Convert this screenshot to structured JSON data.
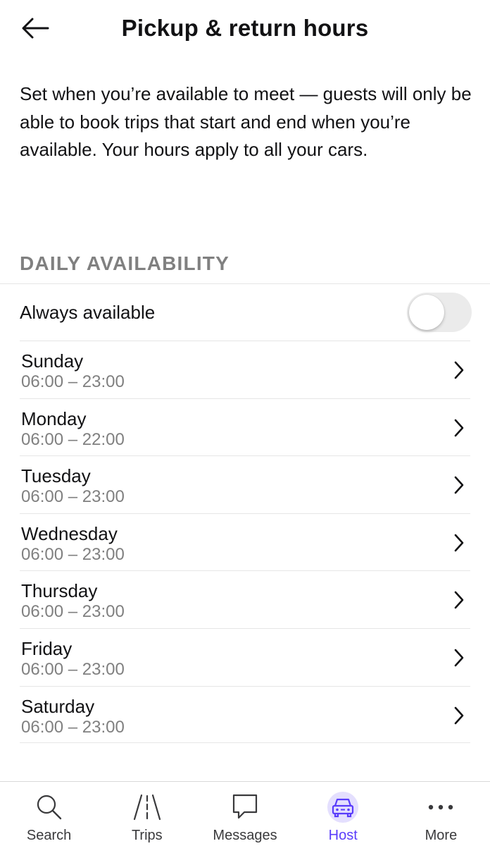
{
  "header": {
    "title": "Pickup & return hours"
  },
  "intro": "Set when you’re available to meet — guests will only be able to book trips that start and end when you’re available. Your hours apply to all your cars.",
  "section_label": "DAILY AVAILABILITY",
  "always_available": {
    "label": "Always available",
    "enabled": false
  },
  "days": [
    {
      "name": "Sunday",
      "hours": "06:00 – 23:00"
    },
    {
      "name": "Monday",
      "hours": "06:00 – 22:00"
    },
    {
      "name": "Tuesday",
      "hours": "06:00 – 23:00"
    },
    {
      "name": "Wednesday",
      "hours": "06:00 – 23:00"
    },
    {
      "name": "Thursday",
      "hours": "06:00 – 23:00"
    },
    {
      "name": "Friday",
      "hours": "06:00 – 23:00"
    },
    {
      "name": "Saturday",
      "hours": "06:00 – 23:00"
    }
  ],
  "tabbar": {
    "active": "Host",
    "active_color": "#593cfb",
    "items": [
      {
        "label": "Search",
        "icon": "search-icon"
      },
      {
        "label": "Trips",
        "icon": "road-icon"
      },
      {
        "label": "Messages",
        "icon": "chat-bubble-icon"
      },
      {
        "label": "Host",
        "icon": "car-icon"
      },
      {
        "label": "More",
        "icon": "more-dots-icon"
      }
    ]
  }
}
